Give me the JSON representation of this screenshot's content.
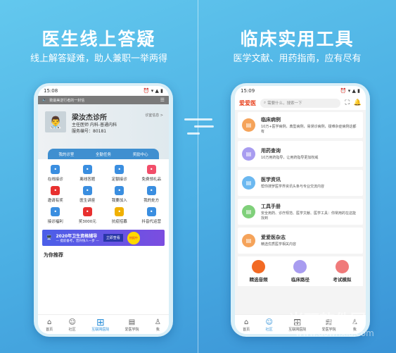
{
  "left": {
    "title": "医生线上答疑",
    "subtitle": "线上解答疑难，助人兼职一举两得",
    "phone": {
      "time": "15:08",
      "notice": "致最美逆行者的一封信",
      "doctor": {
        "name": "梁汝杰诊所",
        "title": "主任医师 内科-普通内科",
        "number": "服务编号：80181",
        "info_link": "诊室信息 >"
      },
      "tabs": [
        "我的诊室",
        "全勤任务",
        "奖励中心"
      ],
      "grid": [
        {
          "label": "在线接诊",
          "color": "#3a8ee0",
          "icon": "medkit-icon"
        },
        {
          "label": "离线答题",
          "color": "#3a8ee0",
          "icon": "note-icon"
        },
        {
          "label": "定额接诊",
          "color": "#3a8ee0",
          "icon": "yen-icon"
        },
        {
          "label": "免费领礼品",
          "color": "#f24e6a",
          "icon": "gift-icon"
        },
        {
          "label": "邀请有奖",
          "color": "#e8302f",
          "icon": "invite-icon"
        },
        {
          "label": "医生讲座",
          "color": "#3a8ee0",
          "icon": "lecture-icon"
        },
        {
          "label": "我要加入",
          "color": "#3a8ee0",
          "icon": "join-icon"
        },
        {
          "label": "我的处方",
          "color": "#3a8ee0",
          "icon": "prescription-icon"
        },
        {
          "label": "接诊福利",
          "color": "#3a8ee0",
          "icon": "welfare-icon"
        },
        {
          "label": "奖3000元",
          "color": "#e8302f",
          "icon": "trophy-icon"
        },
        {
          "label": "抗疫招募",
          "color": "#f0b000",
          "icon": "recruit-icon"
        },
        {
          "label": "抖音代运营",
          "color": "#3a8ee0",
          "icon": "video-icon"
        }
      ],
      "banner": {
        "title": "2020年卫生资格辅导",
        "sub": "— 提前备考，晋升快人一步 —",
        "button": "立即查看",
        "badge": "热报中"
      },
      "recommend": "为你推荐",
      "nav": [
        "首页",
        "社区",
        "互联网医院",
        "爱医学院",
        "我"
      ]
    }
  },
  "right": {
    "title": "临床实用工具",
    "subtitle": "医学文献、用药指南，应有尽有",
    "phone": {
      "time": "15:09",
      "logo": "爱爱医",
      "search_placeholder": "需要什么，搜索一下",
      "cards": [
        {
          "title": "临床病例",
          "desc": "10万+医学病例，典型病例，易误诊病例，疑难杂症病例这都有",
          "color": "#f5a35a"
        },
        {
          "title": "用药查询",
          "desc": "10万用药指导，让用药指导更加权威",
          "color": "#a89cf0"
        },
        {
          "title": "医学资讯",
          "desc": "帮你搜罗医学界资讯头条与专业交流内容",
          "color": "#6bb8f0"
        },
        {
          "title": "工具手册",
          "desc": "安全用药、诊疗规范、医学文献、医学工具：你常用的在这能找到",
          "color": "#7fd07a"
        },
        {
          "title": "爱爱医杂志",
          "desc": "精选优质医学相关内容",
          "color": "#f5a35a"
        }
      ],
      "quick": [
        {
          "label": "精选音频",
          "color": "#f26a24"
        },
        {
          "label": "临床路径",
          "color": "#a89cf0"
        },
        {
          "label": "考试模拟",
          "color": "#f07a7a"
        }
      ],
      "nav": [
        "首页",
        "社区",
        "互联网医院",
        "爱医学院",
        "我"
      ]
    }
  },
  "watermark": {
    "name": "当下软件园",
    "url": "www.downxia.com"
  }
}
